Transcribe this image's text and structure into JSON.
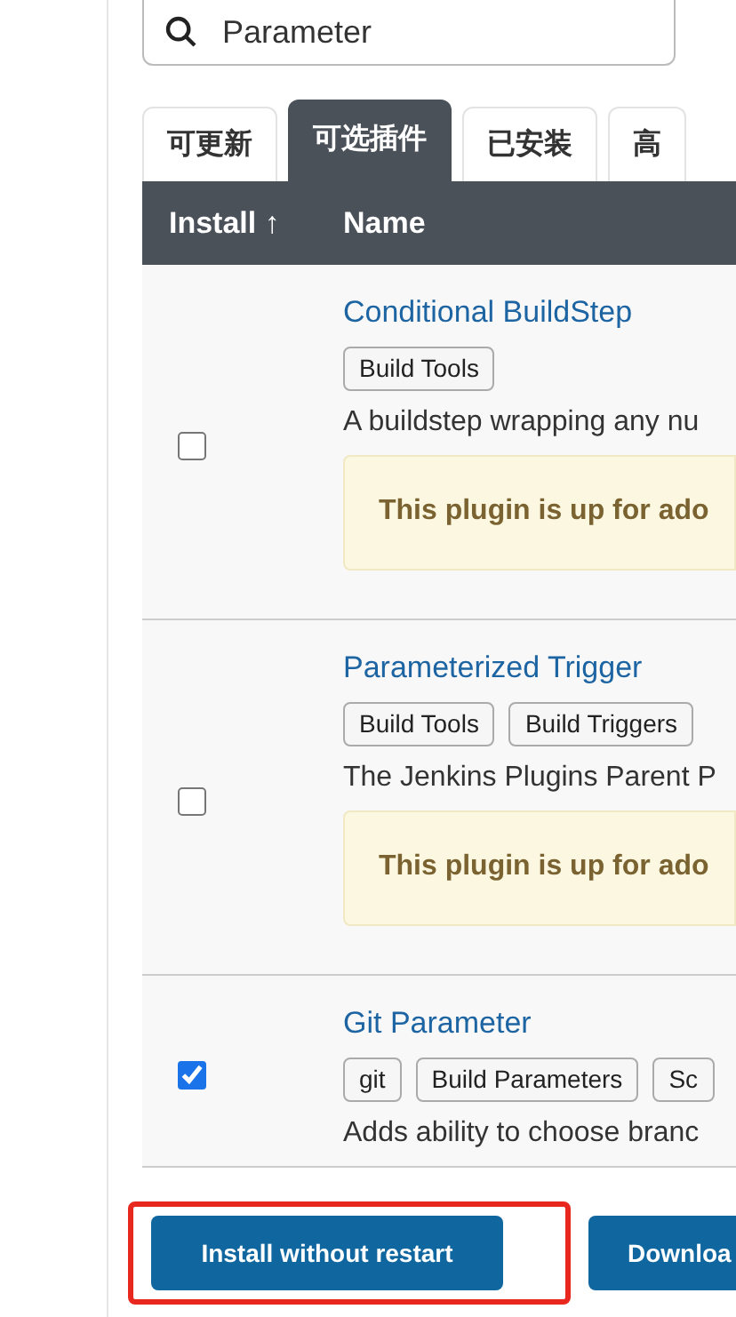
{
  "search": {
    "value": "Parameter"
  },
  "tabs": [
    {
      "label": "可更新",
      "selected": false
    },
    {
      "label": "可选插件",
      "selected": true
    },
    {
      "label": "已安装",
      "selected": false
    },
    {
      "label": "高",
      "selected": false
    }
  ],
  "table": {
    "columns": [
      "Install ↑",
      "Name"
    ],
    "rows": [
      {
        "checked": false,
        "name": "Conditional BuildStep",
        "tags": [
          "Build Tools"
        ],
        "description": "A buildstep wrapping any nu",
        "notice": "This plugin is up for ado"
      },
      {
        "checked": false,
        "name": "Parameterized Trigger",
        "tags": [
          "Build Tools",
          "Build Triggers"
        ],
        "description": "The Jenkins Plugins Parent P",
        "notice": "This plugin is up for ado"
      },
      {
        "checked": true,
        "name": "Git Parameter",
        "tags": [
          "git",
          "Build Parameters",
          "Sc"
        ],
        "description": "Adds ability to choose branc"
      }
    ]
  },
  "buttons": [
    {
      "label": "Install without restart",
      "highlighted": true
    },
    {
      "label": "Downloa",
      "highlighted": false
    }
  ]
}
